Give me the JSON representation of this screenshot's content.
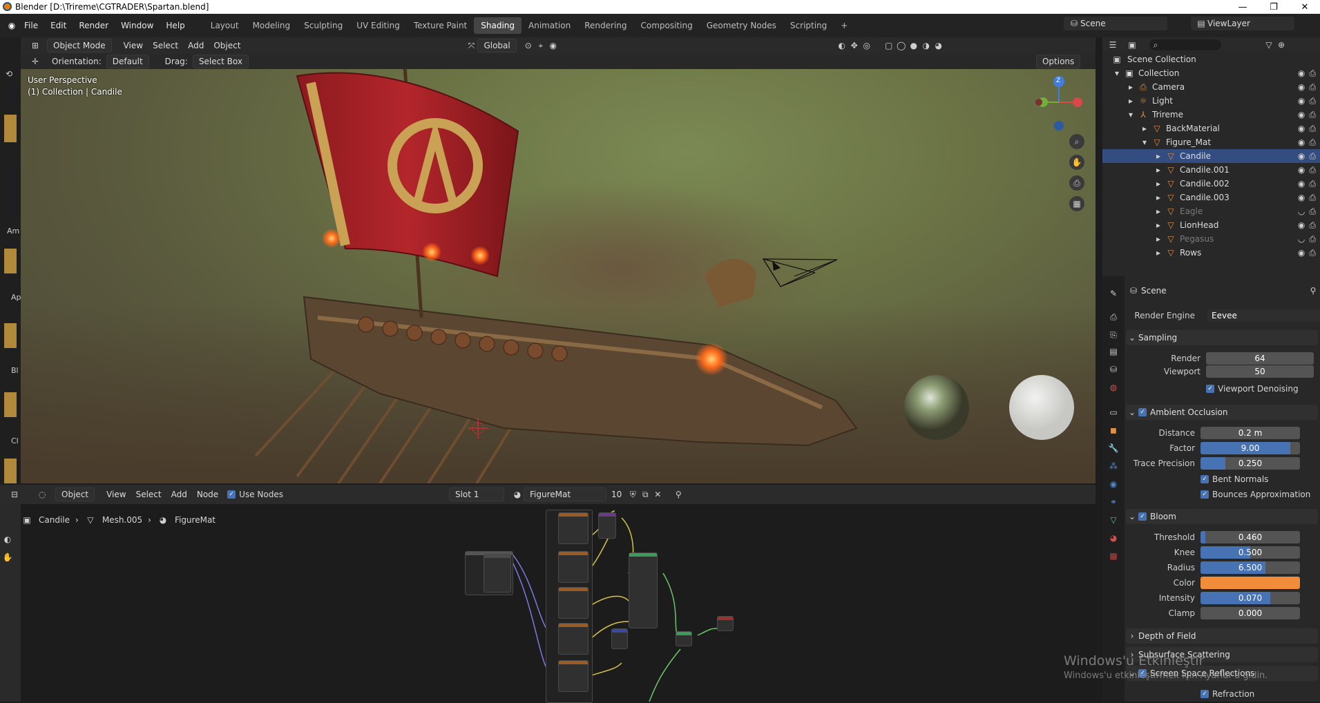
{
  "window": {
    "title": "Blender [D:\\Trireme\\CGTRADER\\Spartan.blend]",
    "minimize": "—",
    "maximize": "❐",
    "close": "✕"
  },
  "menu": [
    "File",
    "Edit",
    "Render",
    "Window",
    "Help"
  ],
  "workspaces": [
    "Layout",
    "Modeling",
    "Sculpting",
    "UV Editing",
    "Texture Paint",
    "Shading",
    "Animation",
    "Rendering",
    "Compositing",
    "Geometry Nodes",
    "Scripting",
    "+"
  ],
  "active_workspace": "Shading",
  "scene_field": "Scene",
  "viewlayer_field": "ViewLayer",
  "viewport_header": {
    "mode": "Object Mode",
    "view": "View",
    "select": "Select",
    "add": "Add",
    "object": "Object",
    "transform": "Global",
    "orientation_label": "Orientation:",
    "orientation_value": "Default",
    "drag_label": "Drag:",
    "drag_value": "Select Box",
    "options": "Options"
  },
  "viewport_overlay": {
    "line1": "User Perspective",
    "line2": "(1) Collection | Candile"
  },
  "gizmo": {
    "z": "Z"
  },
  "outliner": {
    "title": "Scene Collection",
    "rows": [
      {
        "name": "Collection",
        "indent": 1
      },
      {
        "name": "Camera",
        "indent": 2
      },
      {
        "name": "Light",
        "indent": 2
      },
      {
        "name": "Trireme",
        "indent": 2
      },
      {
        "name": "BackMaterial",
        "indent": 3
      },
      {
        "name": "Figure_Mat",
        "indent": 3
      },
      {
        "name": "Candile",
        "indent": 4
      },
      {
        "name": "Candile.001",
        "indent": 4
      },
      {
        "name": "Candile.002",
        "indent": 4
      },
      {
        "name": "Candile.003",
        "indent": 4
      },
      {
        "name": "Eagle",
        "indent": 4,
        "dim": true
      },
      {
        "name": "LionHead",
        "indent": 4
      },
      {
        "name": "Pegasus",
        "indent": 4,
        "dim": true
      },
      {
        "name": "Rows",
        "indent": 4
      }
    ]
  },
  "properties": {
    "context": "Scene",
    "render_engine_label": "Render Engine",
    "render_engine_value": "Eevee",
    "sampling": {
      "title": "Sampling",
      "render_label": "Render",
      "render_value": "64",
      "viewport_label": "Viewport",
      "viewport_value": "50",
      "denoise": "Viewport Denoising"
    },
    "ao": {
      "title": "Ambient Occlusion",
      "distance_label": "Distance",
      "distance_value": "0.2 m",
      "factor_label": "Factor",
      "factor_value": "9.00",
      "factor_fill": 0.9,
      "trace_label": "Trace Precision",
      "trace_value": "0.250",
      "trace_fill": 0.25,
      "bent": "Bent Normals",
      "bounces": "Bounces Approximation"
    },
    "bloom": {
      "title": "Bloom",
      "threshold_label": "Threshold",
      "threshold_value": "0.460",
      "threshold_fill": 0.046,
      "knee_label": "Knee",
      "knee_value": "0.500",
      "knee_fill": 0.5,
      "radius_label": "Radius",
      "radius_value": "6.500",
      "radius_fill": 0.65,
      "color_label": "Color",
      "color": "#f08c3a",
      "intensity_label": "Intensity",
      "intensity_value": "0.070",
      "intensity_fill": 0.7,
      "clamp_label": "Clamp",
      "clamp_value": "0.000"
    },
    "dof": "Depth of Field",
    "sss": "Subsurface Scattering",
    "ssr": "Screen Space Reflections",
    "refraction": "Refraction"
  },
  "node_header": {
    "object": "Object",
    "view": "View",
    "select": "Select",
    "add": "Add",
    "node": "Node",
    "use_nodes": "Use Nodes",
    "slot": "Slot 1",
    "material": "FigureMat",
    "users": "10"
  },
  "breadcrumb": {
    "obj": "Candile",
    "mesh": "Mesh.005",
    "mat": "FigureMat"
  },
  "watermark": {
    "line1": "Windows'u Etkinleştir",
    "line2": "Windows'u etkinleştirmek için Ayarlar'a gidin."
  },
  "left_strip_labels": [
    "Am",
    "Ap",
    "Bl",
    "Cl"
  ]
}
